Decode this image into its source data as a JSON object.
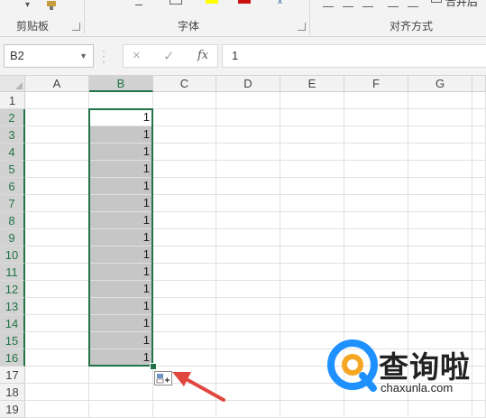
{
  "ribbon": {
    "groups": [
      {
        "label": "剪贴板"
      },
      {
        "label": "字体"
      },
      {
        "label": "对齐方式"
      }
    ],
    "cut_text": "合并后"
  },
  "formula_bar": {
    "name_box": "B2",
    "value": "1",
    "cancel_icon": "×",
    "enter_icon": "✓",
    "fx_label": "fx"
  },
  "columns": [
    "A",
    "B",
    "C",
    "D",
    "E",
    "F",
    "G"
  ],
  "rows": [
    "1",
    "2",
    "3",
    "4",
    "5",
    "6",
    "7",
    "8",
    "9",
    "10",
    "11",
    "12",
    "13",
    "14",
    "15",
    "16",
    "17",
    "18",
    "19"
  ],
  "column_b_values": [
    "",
    "1",
    "1",
    "1",
    "1",
    "1",
    "1",
    "1",
    "1",
    "1",
    "1",
    "1",
    "1",
    "1",
    "1",
    "1",
    "",
    "",
    ""
  ],
  "selection": {
    "range": "B2:B16",
    "active_cell": "B2"
  },
  "watermark": {
    "logo_text": "查询啦",
    "url": "chaxunla.com"
  },
  "colors": {
    "excel_green": "#217346",
    "selection_fill": "#c6c6c6",
    "arrow_red": "#e0473f",
    "logo_blue": "#1e90ff",
    "logo_orange": "#f5a623"
  }
}
